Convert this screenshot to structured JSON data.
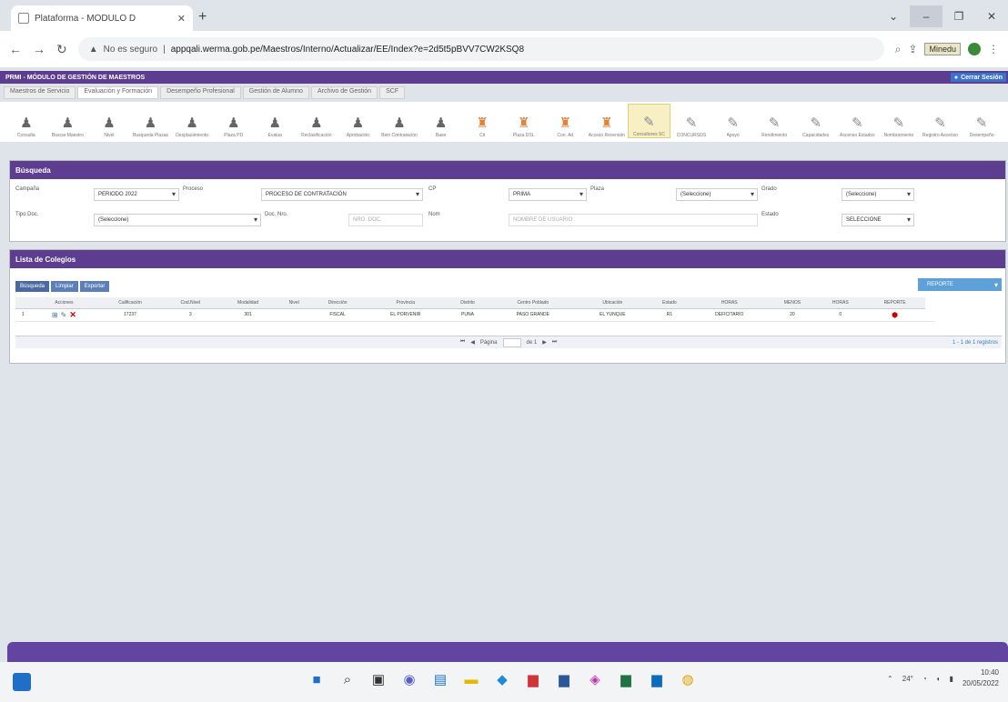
{
  "browser": {
    "tab_title": "Plataforma - MÓDULO D",
    "url_warning": "No es seguro",
    "url": "appqali.werma.gob.pe/Maestros/Interno/Actualizar/EE/Index?e=2d5t5pBVV7CW2KSQ8",
    "profile_badge": "Minedu"
  },
  "app": {
    "header_title": "PRMI - MÓDULO DE GESTIÓN DE MAESTROS",
    "logout_label": "Cerrar Sesión",
    "main_tabs": [
      {
        "label": "Maestros de Servicio",
        "active": false
      },
      {
        "label": "Evaluación y Formación",
        "active": true
      },
      {
        "label": "Desempeño Profesional",
        "active": false
      },
      {
        "label": "Gestión de Alumno",
        "active": false
      },
      {
        "label": "Archivo de Gestión",
        "active": false
      },
      {
        "label": "SCF",
        "active": false
      }
    ],
    "toolbar_icons": [
      {
        "name": "person-icon",
        "label": "Consulta",
        "kind": "person"
      },
      {
        "name": "person-icon",
        "label": "Buscar Maestro",
        "kind": "person"
      },
      {
        "name": "person-icon",
        "label": "Nivel",
        "kind": "person"
      },
      {
        "name": "person-icon",
        "label": "Busqueda Plazas",
        "kind": "person"
      },
      {
        "name": "person-icon",
        "label": "Desplazamiento",
        "kind": "person"
      },
      {
        "name": "person-icon",
        "label": "Plaza PD",
        "kind": "person"
      },
      {
        "name": "person-icon",
        "label": "Evalua",
        "kind": "person"
      },
      {
        "name": "person-icon",
        "label": "Reclasificación",
        "kind": "person"
      },
      {
        "name": "person-icon",
        "label": "Aprobación",
        "kind": "person"
      },
      {
        "name": "person-icon",
        "label": "Bien Contratación",
        "kind": "person"
      },
      {
        "name": "person-icon",
        "label": "Base",
        "kind": "person"
      },
      {
        "name": "teacher-icon",
        "label": "Cit",
        "kind": "teacher"
      },
      {
        "name": "teacher-icon",
        "label": "Plaza DSL",
        "kind": "teacher"
      },
      {
        "name": "teacher-icon",
        "label": "Con. Ad",
        "kind": "teacher"
      },
      {
        "name": "teacher-icon",
        "label": "Acceso Reversión",
        "kind": "teacher"
      },
      {
        "name": "pen-icon",
        "label": "Consultores SC",
        "kind": "pen",
        "highlighted": true
      },
      {
        "name": "pen-icon",
        "label": "CONCURSOS",
        "kind": "pen"
      },
      {
        "name": "pen-icon",
        "label": "Apoyo",
        "kind": "pen"
      },
      {
        "name": "pen-icon",
        "label": "Rendimiento",
        "kind": "pen"
      },
      {
        "name": "pen-icon",
        "label": "Capacidades",
        "kind": "pen"
      },
      {
        "name": "pen-icon",
        "label": "Ascenso Estados",
        "kind": "pen"
      },
      {
        "name": "pen-icon",
        "label": "Nombramiento",
        "kind": "pen"
      },
      {
        "name": "pen-icon",
        "label": "Registro Ascenso",
        "kind": "pen"
      },
      {
        "name": "pen-icon",
        "label": "Desempeño",
        "kind": "pen"
      }
    ],
    "search": {
      "title": "Búsqueda",
      "row1": {
        "campaign_label": "Campaña",
        "campaign_value": "PERIODO 2022",
        "process_label": "Proceso",
        "process_value": "PROCESO DE CONTRATACIÓN",
        "cp_label": "CP",
        "cp_value": "PRIMA",
        "plaza_label": "Plaza",
        "plaza_value": "(Seleccione)",
        "grade_label": "Grado",
        "grade_value": "(Seleccione)"
      },
      "row2": {
        "doc_type_label": "Tipo Doc.",
        "doc_type_value": "(Seleccione)",
        "doc_number_label": "Doc. Nro.",
        "doc_number_placeholder": "NRO. DOC.",
        "name_label": "Nom",
        "name_placeholder": "NOMBRE DE USUARIO",
        "status_label": "Estado",
        "status_value": "SELECCIONE"
      }
    },
    "list": {
      "title": "Lista de Colegios",
      "tools": [
        "Búsqueda",
        "Limpiar",
        "Exportar"
      ],
      "report_label": "REPORTE",
      "columns": [
        "",
        "Acciones",
        "Calificación",
        "Cod.Nivel",
        "Modalidad",
        "Nivel",
        "Dirección",
        "Provincia",
        "Distrito",
        "Centro Poblado",
        "Ubicación",
        "Estado",
        "HORAS",
        "MENOS",
        "HORAS",
        "REPORTE"
      ],
      "rows": [
        [
          "1",
          "",
          "17237",
          "3",
          "301",
          "",
          "FISCAL",
          "EL PORVENIR",
          "PUNA",
          "PASO GRANDE",
          "EL YUNQUE",
          "R1",
          "DEFICITARIO",
          "20",
          "0",
          "0",
          ""
        ]
      ],
      "pager": {
        "page_label": "Página",
        "of_label": "de 1",
        "right_text": "1 - 1 de 1 registros"
      }
    }
  },
  "taskbar": {
    "weather": "24°",
    "time": "10:40",
    "date": "20/05/2022"
  }
}
